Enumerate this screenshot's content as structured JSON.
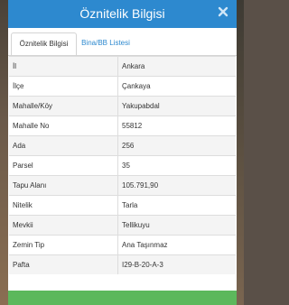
{
  "window": {
    "title": "Öznitelik Bilgisi",
    "close_icon": "close-icon"
  },
  "tabs": [
    {
      "label": "Öznitelik Bilgisi",
      "active": true
    },
    {
      "label": "Bina/BB Listesi",
      "active": false
    }
  ],
  "attributes": [
    {
      "key": "İl",
      "value": "Ankara"
    },
    {
      "key": "İlçe",
      "value": "Çankaya"
    },
    {
      "key": "Mahalle/Köy",
      "value": "Yakupabdal"
    },
    {
      "key": "Mahalle No",
      "value": "55812"
    },
    {
      "key": "Ada",
      "value": "256"
    },
    {
      "key": "Parsel",
      "value": "35"
    },
    {
      "key": "Tapu Alanı",
      "value": "105.791,90"
    },
    {
      "key": "Nitelik",
      "value": "Tarla"
    },
    {
      "key": "Mevkii",
      "value": "Tellikuyu"
    },
    {
      "key": "Zemin Tip",
      "value": "Ana Taşınmaz"
    },
    {
      "key": "Pafta",
      "value": "I29-B-20-A-3"
    }
  ],
  "colors": {
    "header": "#2d89cf",
    "footer": "#5cb85c",
    "tab_link": "#2d89cf"
  }
}
